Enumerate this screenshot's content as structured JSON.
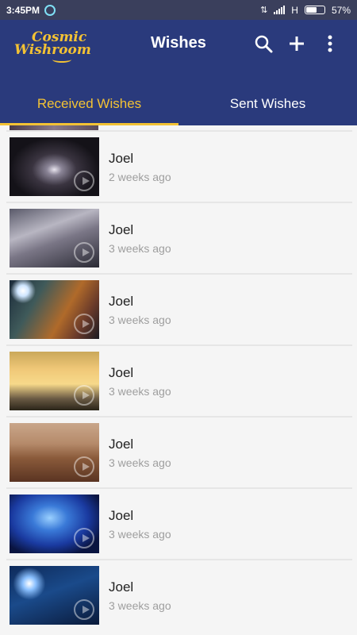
{
  "status_bar": {
    "time": "3:45PM",
    "network": "H",
    "battery": "57%",
    "battery_level": 0.57
  },
  "app_bar": {
    "logo_line1": "Cosmic",
    "logo_line2": "Wishroom",
    "title": "Wishes",
    "icons": [
      "search-icon",
      "add-icon",
      "more-vert-icon"
    ]
  },
  "tabs": [
    {
      "label": "Received Wishes",
      "active": true
    },
    {
      "label": "Sent Wishes",
      "active": false
    }
  ],
  "wishes": [
    {
      "name": "Joel",
      "time": "2 weeks ago",
      "thumb": "galaxy"
    },
    {
      "name": "Joel",
      "time": "3 weeks ago",
      "thumb": "milkyway"
    },
    {
      "name": "Joel",
      "time": "3 weeks ago",
      "thumb": "nebula-star"
    },
    {
      "name": "Joel",
      "time": "3 weeks ago",
      "thumb": "sunset-clouds"
    },
    {
      "name": "Joel",
      "time": "3 weeks ago",
      "thumb": "desert-rays"
    },
    {
      "name": "Joel",
      "time": "3 weeks ago",
      "thumb": "blue-nebula"
    },
    {
      "name": "Joel",
      "time": "3 weeks ago",
      "thumb": "blue-star"
    }
  ],
  "colors": {
    "app_bar": "#2a3a7c",
    "accent": "#f3c234",
    "status_bar": "#3a3f5c"
  }
}
